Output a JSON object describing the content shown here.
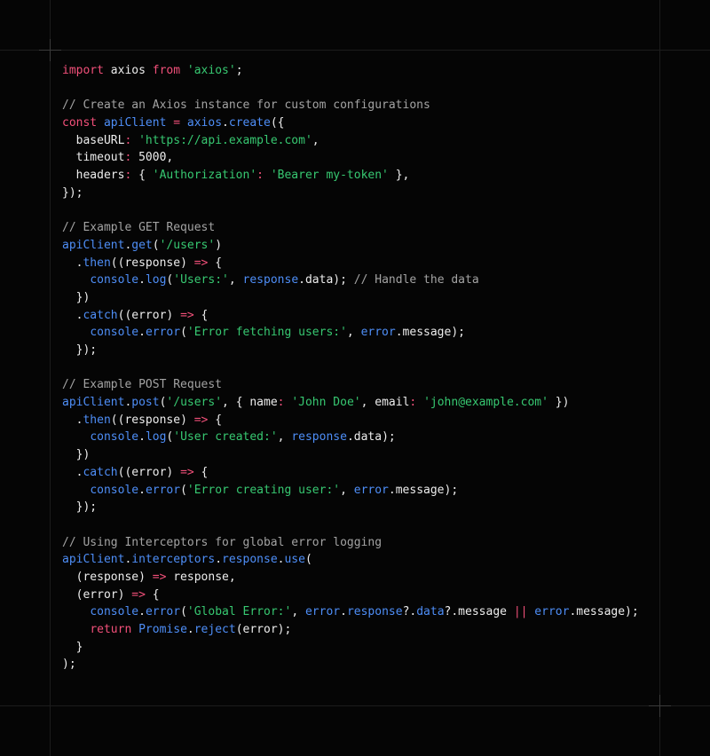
{
  "code": {
    "language": "javascript",
    "lines": [
      [
        [
          "k",
          "import"
        ],
        [
          "p",
          " axios "
        ],
        [
          "k",
          "from"
        ],
        [
          "p",
          " "
        ],
        [
          "s",
          "'axios'"
        ],
        [
          "p",
          ";"
        ]
      ],
      [],
      [
        [
          "c",
          "// Create an Axios instance for custom configurations"
        ]
      ],
      [
        [
          "k",
          "const"
        ],
        [
          "p",
          " "
        ],
        [
          "f",
          "apiClient"
        ],
        [
          "p",
          " "
        ],
        [
          "k",
          "="
        ],
        [
          "p",
          " "
        ],
        [
          "f",
          "axios"
        ],
        [
          "p",
          "."
        ],
        [
          "f",
          "create"
        ],
        [
          "p",
          "({"
        ]
      ],
      [
        [
          "p",
          "  baseURL"
        ],
        [
          "k",
          ":"
        ],
        [
          "p",
          " "
        ],
        [
          "s",
          "'https://api.example.com'"
        ],
        [
          "p",
          ","
        ]
      ],
      [
        [
          "p",
          "  timeout"
        ],
        [
          "k",
          ":"
        ],
        [
          "p",
          " 5000,"
        ]
      ],
      [
        [
          "p",
          "  headers"
        ],
        [
          "k",
          ":"
        ],
        [
          "p",
          " { "
        ],
        [
          "s",
          "'Authorization'"
        ],
        [
          "k",
          ":"
        ],
        [
          "p",
          " "
        ],
        [
          "s",
          "'Bearer my-token'"
        ],
        [
          "p",
          " },"
        ]
      ],
      [
        [
          "p",
          "});"
        ]
      ],
      [],
      [
        [
          "c",
          "// Example GET Request"
        ]
      ],
      [
        [
          "f",
          "apiClient"
        ],
        [
          "p",
          "."
        ],
        [
          "f",
          "get"
        ],
        [
          "p",
          "("
        ],
        [
          "s",
          "'/users'"
        ],
        [
          "p",
          ")"
        ]
      ],
      [
        [
          "p",
          "  ."
        ],
        [
          "f",
          "then"
        ],
        [
          "p",
          "((response) "
        ],
        [
          "k",
          "=>"
        ],
        [
          "p",
          " {"
        ]
      ],
      [
        [
          "p",
          "    "
        ],
        [
          "f",
          "console"
        ],
        [
          "p",
          "."
        ],
        [
          "f",
          "log"
        ],
        [
          "p",
          "("
        ],
        [
          "s",
          "'Users:'"
        ],
        [
          "p",
          ", "
        ],
        [
          "f",
          "response"
        ],
        [
          "p",
          ".data); "
        ],
        [
          "c",
          "// Handle the data"
        ]
      ],
      [
        [
          "p",
          "  })"
        ]
      ],
      [
        [
          "p",
          "  ."
        ],
        [
          "f",
          "catch"
        ],
        [
          "p",
          "((error) "
        ],
        [
          "k",
          "=>"
        ],
        [
          "p",
          " {"
        ]
      ],
      [
        [
          "p",
          "    "
        ],
        [
          "f",
          "console"
        ],
        [
          "p",
          "."
        ],
        [
          "f",
          "error"
        ],
        [
          "p",
          "("
        ],
        [
          "s",
          "'Error fetching users:'"
        ],
        [
          "p",
          ", "
        ],
        [
          "f",
          "error"
        ],
        [
          "p",
          ".message);"
        ]
      ],
      [
        [
          "p",
          "  });"
        ]
      ],
      [],
      [
        [
          "c",
          "// Example POST Request"
        ]
      ],
      [
        [
          "f",
          "apiClient"
        ],
        [
          "p",
          "."
        ],
        [
          "f",
          "post"
        ],
        [
          "p",
          "("
        ],
        [
          "s",
          "'/users'"
        ],
        [
          "p",
          ", { name"
        ],
        [
          "k",
          ":"
        ],
        [
          "p",
          " "
        ],
        [
          "s",
          "'John Doe'"
        ],
        [
          "p",
          ", email"
        ],
        [
          "k",
          ":"
        ],
        [
          "p",
          " "
        ],
        [
          "s",
          "'john@example.com'"
        ],
        [
          "p",
          " })"
        ]
      ],
      [
        [
          "p",
          "  ."
        ],
        [
          "f",
          "then"
        ],
        [
          "p",
          "((response) "
        ],
        [
          "k",
          "=>"
        ],
        [
          "p",
          " {"
        ]
      ],
      [
        [
          "p",
          "    "
        ],
        [
          "f",
          "console"
        ],
        [
          "p",
          "."
        ],
        [
          "f",
          "log"
        ],
        [
          "p",
          "("
        ],
        [
          "s",
          "'User created:'"
        ],
        [
          "p",
          ", "
        ],
        [
          "f",
          "response"
        ],
        [
          "p",
          ".data);"
        ]
      ],
      [
        [
          "p",
          "  })"
        ]
      ],
      [
        [
          "p",
          "  ."
        ],
        [
          "f",
          "catch"
        ],
        [
          "p",
          "((error) "
        ],
        [
          "k",
          "=>"
        ],
        [
          "p",
          " {"
        ]
      ],
      [
        [
          "p",
          "    "
        ],
        [
          "f",
          "console"
        ],
        [
          "p",
          "."
        ],
        [
          "f",
          "error"
        ],
        [
          "p",
          "("
        ],
        [
          "s",
          "'Error creating user:'"
        ],
        [
          "p",
          ", "
        ],
        [
          "f",
          "error"
        ],
        [
          "p",
          ".message);"
        ]
      ],
      [
        [
          "p",
          "  });"
        ]
      ],
      [],
      [
        [
          "c",
          "// Using Interceptors for global error logging"
        ]
      ],
      [
        [
          "f",
          "apiClient"
        ],
        [
          "p",
          "."
        ],
        [
          "f",
          "interceptors"
        ],
        [
          "p",
          "."
        ],
        [
          "f",
          "response"
        ],
        [
          "p",
          "."
        ],
        [
          "f",
          "use"
        ],
        [
          "p",
          "("
        ]
      ],
      [
        [
          "p",
          "  (response) "
        ],
        [
          "k",
          "=>"
        ],
        [
          "p",
          " response,"
        ]
      ],
      [
        [
          "p",
          "  (error) "
        ],
        [
          "k",
          "=>"
        ],
        [
          "p",
          " {"
        ]
      ],
      [
        [
          "p",
          "    "
        ],
        [
          "f",
          "console"
        ],
        [
          "p",
          "."
        ],
        [
          "f",
          "error"
        ],
        [
          "p",
          "("
        ],
        [
          "s",
          "'Global Error:'"
        ],
        [
          "p",
          ", "
        ],
        [
          "f",
          "error"
        ],
        [
          "p",
          "."
        ],
        [
          "f",
          "response"
        ],
        [
          "p",
          "?."
        ],
        [
          "f",
          "data"
        ],
        [
          "p",
          "?.message "
        ],
        [
          "k",
          "||"
        ],
        [
          "p",
          " "
        ],
        [
          "f",
          "error"
        ],
        [
          "p",
          ".message);"
        ]
      ],
      [
        [
          "p",
          "    "
        ],
        [
          "k",
          "return"
        ],
        [
          "p",
          " "
        ],
        [
          "f",
          "Promise"
        ],
        [
          "p",
          "."
        ],
        [
          "f",
          "reject"
        ],
        [
          "p",
          "(error);"
        ]
      ],
      [
        [
          "p",
          "  }"
        ]
      ],
      [
        [
          "p",
          ");"
        ]
      ]
    ]
  },
  "theme": {
    "background": "#050505",
    "keyword": "#f2507a",
    "string": "#37c871",
    "comment": "#a3a3a3",
    "identifier": "#4e8ef7",
    "text": "#ededed"
  }
}
